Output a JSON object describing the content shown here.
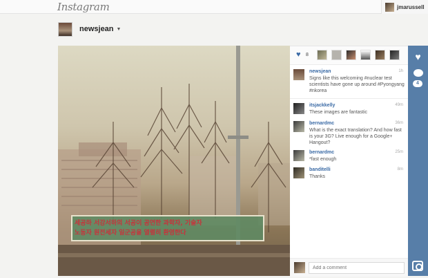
{
  "app": {
    "logo_text": "Instagram"
  },
  "header": {
    "username": "jmarussell"
  },
  "post": {
    "owner": "newsjean",
    "likes_count": "8",
    "comments_count": "4",
    "comments": [
      {
        "user": "newsjean",
        "time": "1h",
        "text": "Signs like this welcoming #nuclear test scientists have gone up around #Pyongyang #nkorea"
      },
      {
        "user": "itsjackkelly",
        "time": "49m",
        "text": "These images are fantastic"
      },
      {
        "user": "bernardmc",
        "time": "36m",
        "text": "What is the exact translation? And how fast is your 3G? Live enough for a Google+ Hangout?"
      },
      {
        "user": "bernardmc",
        "time": "25m",
        "text": "*fast enough"
      },
      {
        "user": "banditelli",
        "time": "8m",
        "text": "Thanks"
      }
    ],
    "add_comment_placeholder": "Add a comment",
    "banner_text_line1": "세공하  서강서하의 서공이 공연한 과학자, 기술자",
    "banner_text_line2": "노동자  원전세자 일군공을 열렬히 환영한다"
  },
  "colors": {
    "accent": "#577ea8",
    "link": "#3a6aa5"
  }
}
